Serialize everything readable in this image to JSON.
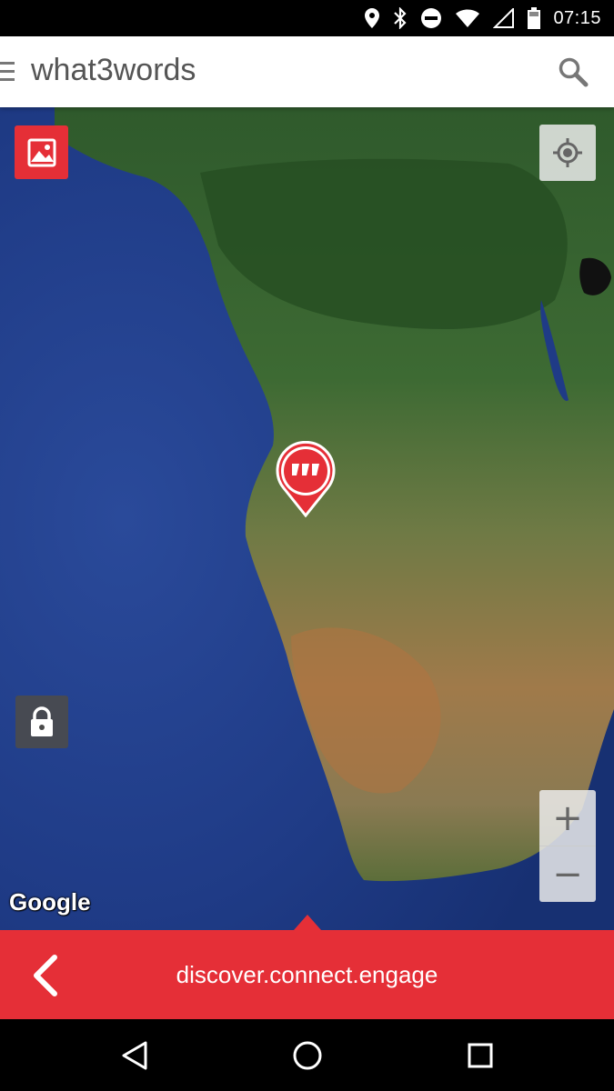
{
  "status_bar": {
    "time": "07:15",
    "icons": [
      "location-icon",
      "bluetooth-icon",
      "do-not-disturb-icon",
      "wifi-icon",
      "signal-icon",
      "battery-icon"
    ]
  },
  "app_bar": {
    "title": "what3words",
    "icons": [
      "menu-icon",
      "search-icon"
    ]
  },
  "map": {
    "type": "satellite",
    "attribution": "Google",
    "controls": [
      "photo-icon",
      "my-location-icon",
      "lock-icon"
    ],
    "zoom_in_label": "+",
    "zoom_out_label": "−"
  },
  "word_bar": {
    "address": "discover.connect.engage",
    "back_icon": "chevron-left-icon"
  },
  "nav_bar": {
    "icons": [
      "back-triangle-icon",
      "home-circle-icon",
      "recents-square-icon"
    ]
  },
  "colors": {
    "brand_red": "#e52f37",
    "app_title": "#555555"
  }
}
